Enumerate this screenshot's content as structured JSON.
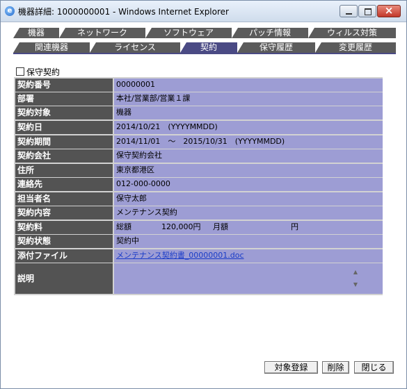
{
  "window": {
    "title": "機器詳細: 1000000001 - Windows Internet Explorer"
  },
  "tabs": {
    "row1": [
      "機器",
      "ネットワーク",
      "ソフトウェア",
      "パッチ情報",
      "ウィルス対策"
    ],
    "row2": [
      "関連機器",
      "ライセンス",
      "契約",
      "保守履歴",
      "変更履歴"
    ],
    "active": "契約"
  },
  "maintenance_checkbox": {
    "label": "保守契約",
    "checked": false
  },
  "details": {
    "contract_no": {
      "label": "契約番号",
      "value": "00000001"
    },
    "department": {
      "label": "部署",
      "value": "本社/営業部/営業１課"
    },
    "target": {
      "label": "契約対象",
      "value": "機器"
    },
    "contract_date": {
      "label": "契約日",
      "value": "2014/10/21　(YYYYMMDD)"
    },
    "period": {
      "label": "契約期間",
      "value": "2014/11/01　～　2015/10/31　(YYYYMMDD)"
    },
    "company": {
      "label": "契約会社",
      "value": "保守契約会社"
    },
    "address": {
      "label": "住所",
      "value": "東京都港区"
    },
    "contact": {
      "label": "連絡先",
      "value": "012-000-0000"
    },
    "person": {
      "label": "担当者名",
      "value": "保守太郎"
    },
    "content": {
      "label": "契約内容",
      "value": "メンテナンス契約"
    },
    "fee": {
      "label": "契約料",
      "total_label": "総額",
      "total_value": "120,000円",
      "monthly_label": "月額",
      "monthly_unit": "円"
    },
    "status": {
      "label": "契約状態",
      "value": "契約中"
    },
    "attachment": {
      "label": "添付ファイル",
      "value": "メンテナンス契約書_00000001.doc"
    },
    "description": {
      "label": "説明",
      "value": ""
    }
  },
  "buttons": {
    "register": "対象登録",
    "delete": "削除",
    "close": "閉じる"
  }
}
